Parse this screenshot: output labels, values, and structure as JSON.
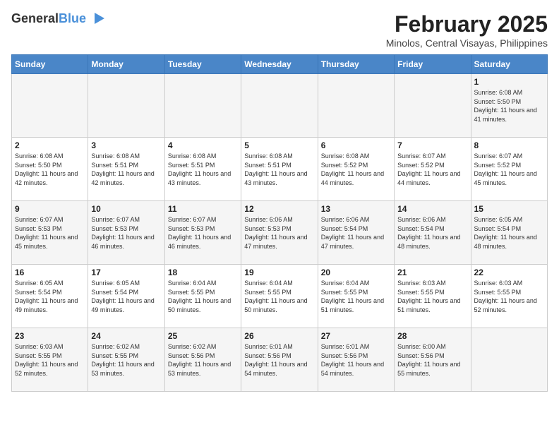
{
  "header": {
    "logo_general": "General",
    "logo_blue": "Blue",
    "month_title": "February 2025",
    "location": "Minolos, Central Visayas, Philippines"
  },
  "weekdays": [
    "Sunday",
    "Monday",
    "Tuesday",
    "Wednesday",
    "Thursday",
    "Friday",
    "Saturday"
  ],
  "weeks": [
    [
      {
        "day": "",
        "info": ""
      },
      {
        "day": "",
        "info": ""
      },
      {
        "day": "",
        "info": ""
      },
      {
        "day": "",
        "info": ""
      },
      {
        "day": "",
        "info": ""
      },
      {
        "day": "",
        "info": ""
      },
      {
        "day": "1",
        "info": "Sunrise: 6:08 AM\nSunset: 5:50 PM\nDaylight: 11 hours and 41 minutes."
      }
    ],
    [
      {
        "day": "2",
        "info": "Sunrise: 6:08 AM\nSunset: 5:50 PM\nDaylight: 11 hours and 42 minutes."
      },
      {
        "day": "3",
        "info": "Sunrise: 6:08 AM\nSunset: 5:51 PM\nDaylight: 11 hours and 42 minutes."
      },
      {
        "day": "4",
        "info": "Sunrise: 6:08 AM\nSunset: 5:51 PM\nDaylight: 11 hours and 43 minutes."
      },
      {
        "day": "5",
        "info": "Sunrise: 6:08 AM\nSunset: 5:51 PM\nDaylight: 11 hours and 43 minutes."
      },
      {
        "day": "6",
        "info": "Sunrise: 6:08 AM\nSunset: 5:52 PM\nDaylight: 11 hours and 44 minutes."
      },
      {
        "day": "7",
        "info": "Sunrise: 6:07 AM\nSunset: 5:52 PM\nDaylight: 11 hours and 44 minutes."
      },
      {
        "day": "8",
        "info": "Sunrise: 6:07 AM\nSunset: 5:52 PM\nDaylight: 11 hours and 45 minutes."
      }
    ],
    [
      {
        "day": "9",
        "info": "Sunrise: 6:07 AM\nSunset: 5:53 PM\nDaylight: 11 hours and 45 minutes."
      },
      {
        "day": "10",
        "info": "Sunrise: 6:07 AM\nSunset: 5:53 PM\nDaylight: 11 hours and 46 minutes."
      },
      {
        "day": "11",
        "info": "Sunrise: 6:07 AM\nSunset: 5:53 PM\nDaylight: 11 hours and 46 minutes."
      },
      {
        "day": "12",
        "info": "Sunrise: 6:06 AM\nSunset: 5:53 PM\nDaylight: 11 hours and 47 minutes."
      },
      {
        "day": "13",
        "info": "Sunrise: 6:06 AM\nSunset: 5:54 PM\nDaylight: 11 hours and 47 minutes."
      },
      {
        "day": "14",
        "info": "Sunrise: 6:06 AM\nSunset: 5:54 PM\nDaylight: 11 hours and 48 minutes."
      },
      {
        "day": "15",
        "info": "Sunrise: 6:05 AM\nSunset: 5:54 PM\nDaylight: 11 hours and 48 minutes."
      }
    ],
    [
      {
        "day": "16",
        "info": "Sunrise: 6:05 AM\nSunset: 5:54 PM\nDaylight: 11 hours and 49 minutes."
      },
      {
        "day": "17",
        "info": "Sunrise: 6:05 AM\nSunset: 5:54 PM\nDaylight: 11 hours and 49 minutes."
      },
      {
        "day": "18",
        "info": "Sunrise: 6:04 AM\nSunset: 5:55 PM\nDaylight: 11 hours and 50 minutes."
      },
      {
        "day": "19",
        "info": "Sunrise: 6:04 AM\nSunset: 5:55 PM\nDaylight: 11 hours and 50 minutes."
      },
      {
        "day": "20",
        "info": "Sunrise: 6:04 AM\nSunset: 5:55 PM\nDaylight: 11 hours and 51 minutes."
      },
      {
        "day": "21",
        "info": "Sunrise: 6:03 AM\nSunset: 5:55 PM\nDaylight: 11 hours and 51 minutes."
      },
      {
        "day": "22",
        "info": "Sunrise: 6:03 AM\nSunset: 5:55 PM\nDaylight: 11 hours and 52 minutes."
      }
    ],
    [
      {
        "day": "23",
        "info": "Sunrise: 6:03 AM\nSunset: 5:55 PM\nDaylight: 11 hours and 52 minutes."
      },
      {
        "day": "24",
        "info": "Sunrise: 6:02 AM\nSunset: 5:55 PM\nDaylight: 11 hours and 53 minutes."
      },
      {
        "day": "25",
        "info": "Sunrise: 6:02 AM\nSunset: 5:56 PM\nDaylight: 11 hours and 53 minutes."
      },
      {
        "day": "26",
        "info": "Sunrise: 6:01 AM\nSunset: 5:56 PM\nDaylight: 11 hours and 54 minutes."
      },
      {
        "day": "27",
        "info": "Sunrise: 6:01 AM\nSunset: 5:56 PM\nDaylight: 11 hours and 54 minutes."
      },
      {
        "day": "28",
        "info": "Sunrise: 6:00 AM\nSunset: 5:56 PM\nDaylight: 11 hours and 55 minutes."
      },
      {
        "day": "",
        "info": ""
      }
    ]
  ]
}
